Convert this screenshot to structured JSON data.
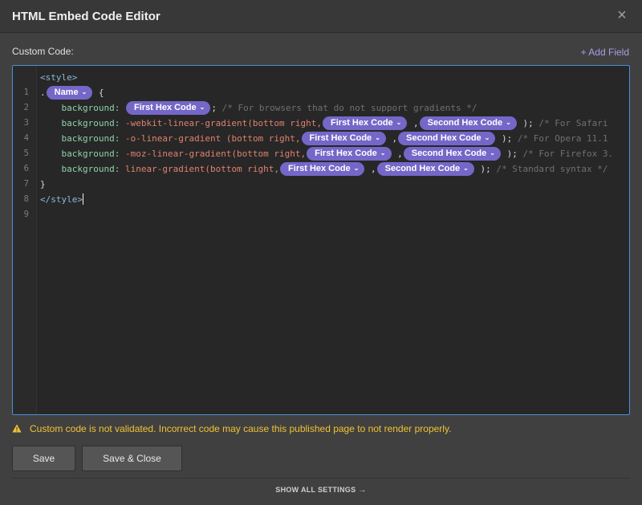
{
  "window": {
    "title": "HTML Embed Code Editor",
    "close_icon": "×"
  },
  "field": {
    "label": "Custom Code:",
    "add_field": "+ Add Field"
  },
  "editor": {
    "pill_chevron": "⌄",
    "pills": {
      "name": "Name",
      "first_hex": "First Hex Code",
      "second_hex": "Second Hex Code"
    },
    "lines": [
      {
        "num": "1",
        "tag": "<style>"
      },
      {
        "num": "2",
        "dot": ".",
        "brace": " {"
      },
      {
        "num": "3",
        "prop": "background:",
        "end": ";",
        "comment": " /* For browsers that do not support gradients */"
      },
      {
        "num": "4",
        "prop": "background:",
        "fn": "-webkit-linear-gradient",
        "args": "(bottom right,",
        "comma": ",",
        "end": ");",
        "comment": " /* For Safari"
      },
      {
        "num": "5",
        "prop": "background:",
        "fn": "-o-linear-gradient",
        "args": " (bottom right,",
        "comma": ",",
        "end": ");",
        "comment": " /* For Opera 11.1"
      },
      {
        "num": "6",
        "prop": "background:",
        "fn": "-moz-linear-gradient",
        "args": "(bottom right,",
        "comma": ",",
        "end": ");",
        "comment": " /* For Firefox 3."
      },
      {
        "num": "7",
        "prop": "background:",
        "fn": "linear-gradient",
        "args": "(bottom right,",
        "comma": ",",
        "end": ");",
        "comment": " /* Standard syntax */"
      },
      {
        "num": "8",
        "brace": "}"
      },
      {
        "num": "9",
        "tag": "</style>"
      }
    ]
  },
  "warning": {
    "icon": "warning-triangle",
    "text": "Custom code is not validated. Incorrect code may cause this published page to not render properly."
  },
  "buttons": {
    "save": "Save",
    "save_close": "Save & Close"
  },
  "footer": {
    "show_all": "SHOW ALL SETTINGS",
    "arrow": "→"
  },
  "colors": {
    "accent": "#7467c8",
    "focus_border": "#4a8fd9",
    "warning": "#f2c233"
  }
}
